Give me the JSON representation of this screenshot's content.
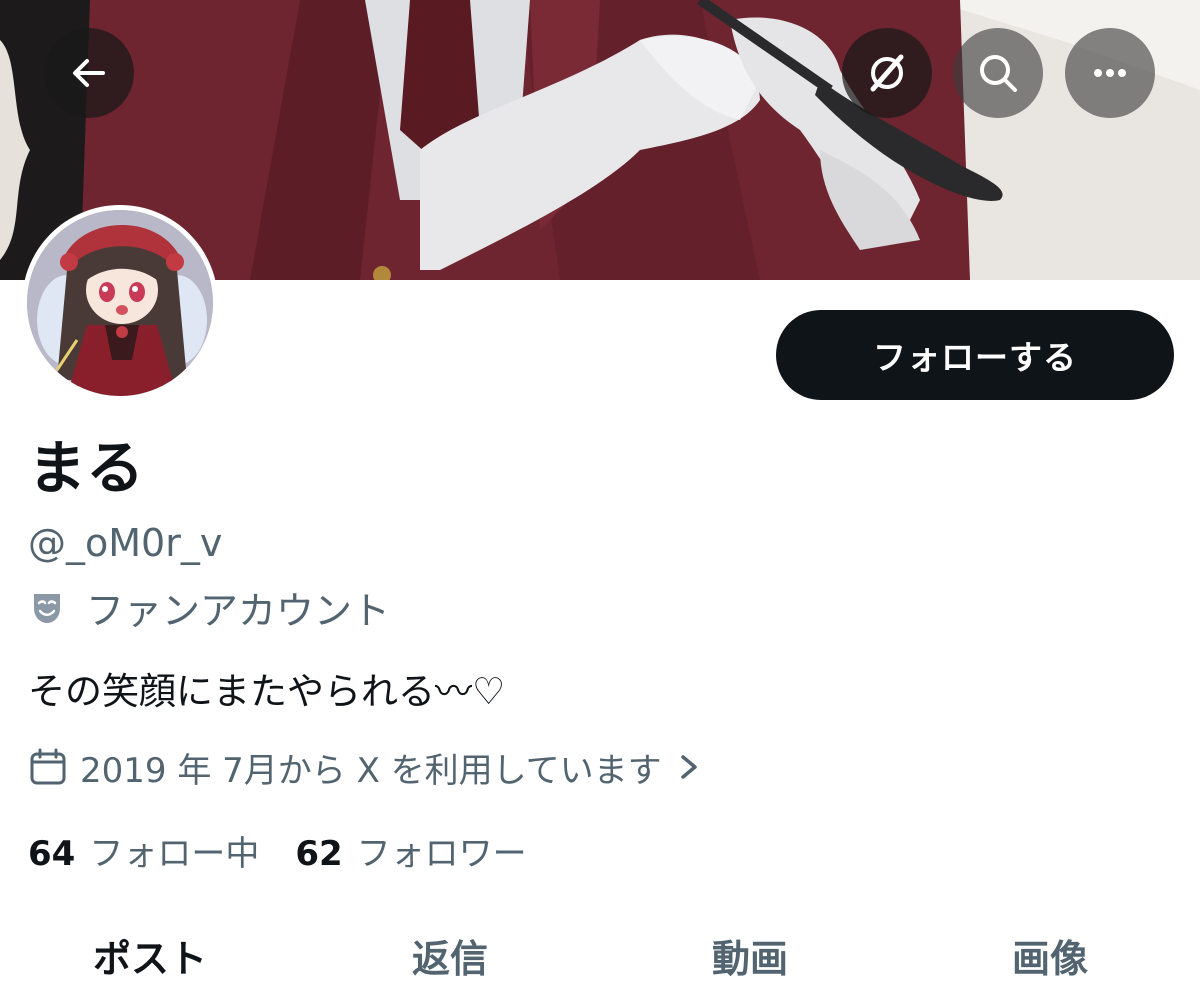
{
  "header": {
    "back_icon": "arrow-left-icon",
    "grok_icon": "grok-icon",
    "search_icon": "search-icon",
    "more_icon": "more-horizontal-icon"
  },
  "profile": {
    "follow_label": "フォローする",
    "display_name": "まる",
    "handle": "@_oM0r_v",
    "category_icon": "theater-mask-icon",
    "category": "ファンアカウント",
    "bio": "その笑顔にまたやられる〰︎♡",
    "joined_icon": "calendar-icon",
    "joined": "2019 年 7月から X を利用しています"
  },
  "stats": {
    "following_count": "64",
    "following_label": "フォロー中",
    "followers_count": "62",
    "followers_label": "フォロワー"
  },
  "tabs": [
    {
      "label": "ポスト",
      "active": true
    },
    {
      "label": "返信",
      "active": false
    },
    {
      "label": "動画",
      "active": false
    },
    {
      "label": "画像",
      "active": false
    }
  ],
  "colors": {
    "primary_text": "#0f1419",
    "secondary_text": "#536471",
    "button_bg": "#0f1419",
    "banner_jacket": "#6e2530"
  }
}
